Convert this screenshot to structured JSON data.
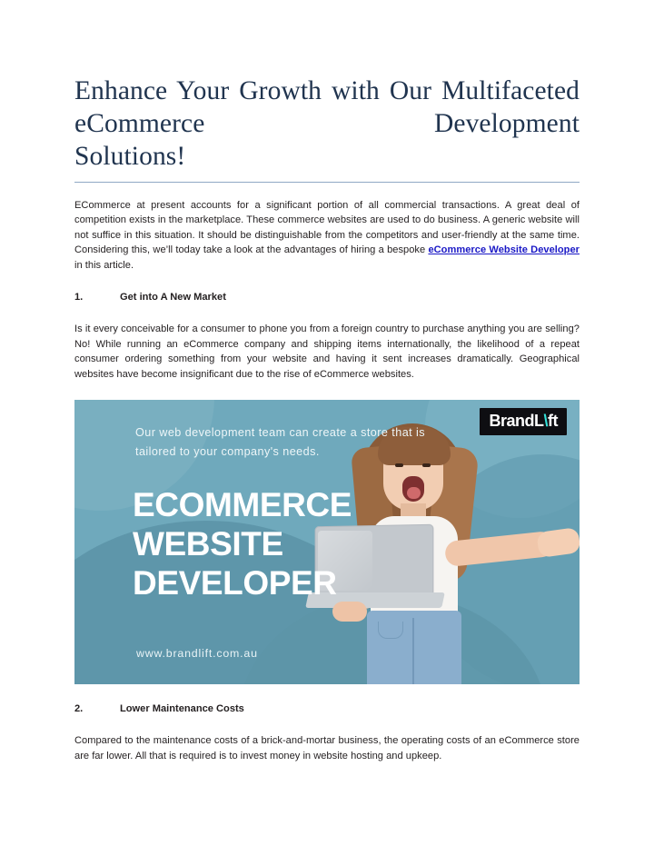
{
  "document": {
    "title_lines": [
      "Enhance Your Growth with Our",
      "Multifaceted eCommerce Development",
      "Solutions!"
    ],
    "title_full": "Enhance Your Growth with Our Multifaceted eCommerce Development Solutions!",
    "title_color": "#20344f",
    "rule_color": "#8fa8c4"
  },
  "intro": {
    "before_link": "ECommerce at present accounts for a significant portion of all commercial transactions. A great deal of competition exists in the marketplace. These commerce websites are used to do business. A generic website will not suffice in this situation. It should be distinguishable from the competitors and user-friendly at the same time. Considering this, we’ll today take a look at the advantages of hiring a bespoke ",
    "link_text": "eCommerce Website Developer",
    "after_link": " in this article.",
    "link_color": "#1a18c6"
  },
  "sections": [
    {
      "number": "1.",
      "heading": "Get into A New Market",
      "body": "Is it every conceivable for a consumer to phone you from a foreign country to purchase anything you are selling? No! While running an eCommerce company and shipping items internationally, the likelihood of a repeat consumer ordering something from your website and having it sent increases dramatically. Geographical websites have become insignificant due to the rise of eCommerce websites."
    },
    {
      "number": "2.",
      "heading": "Lower Maintenance Costs",
      "body": "Compared to the maintenance costs of a brick-and-mortar business, the operating costs of an eCommerce store are far lower. All that is required is to invest money in website hosting and upkeep."
    }
  ],
  "banner": {
    "background_color": "#6fa9bc",
    "accent_dark_color": "#5c95a8",
    "subtitle_lines": [
      "Our web development team can create a store that is",
      "tailored to your company's needs."
    ],
    "subtitle_full": "Our web development team can create a store that is tailored to your company's needs.",
    "headline_lines": [
      "ECOMMERCE",
      "WEBSITE",
      "DEVELOPER"
    ],
    "headline_full": "ECOMMERCE WEBSITE DEVELOPER",
    "url": "www.brandlift.com.au",
    "logo": {
      "prefix": "BrandL",
      "accent": "\\",
      "suffix": "ft",
      "box_color": "#0e0e12",
      "text_color": "#ffffff",
      "accent_color": "#35e0d8"
    },
    "photo_alt": "Smiling woman holding a silver laptop and pointing"
  }
}
